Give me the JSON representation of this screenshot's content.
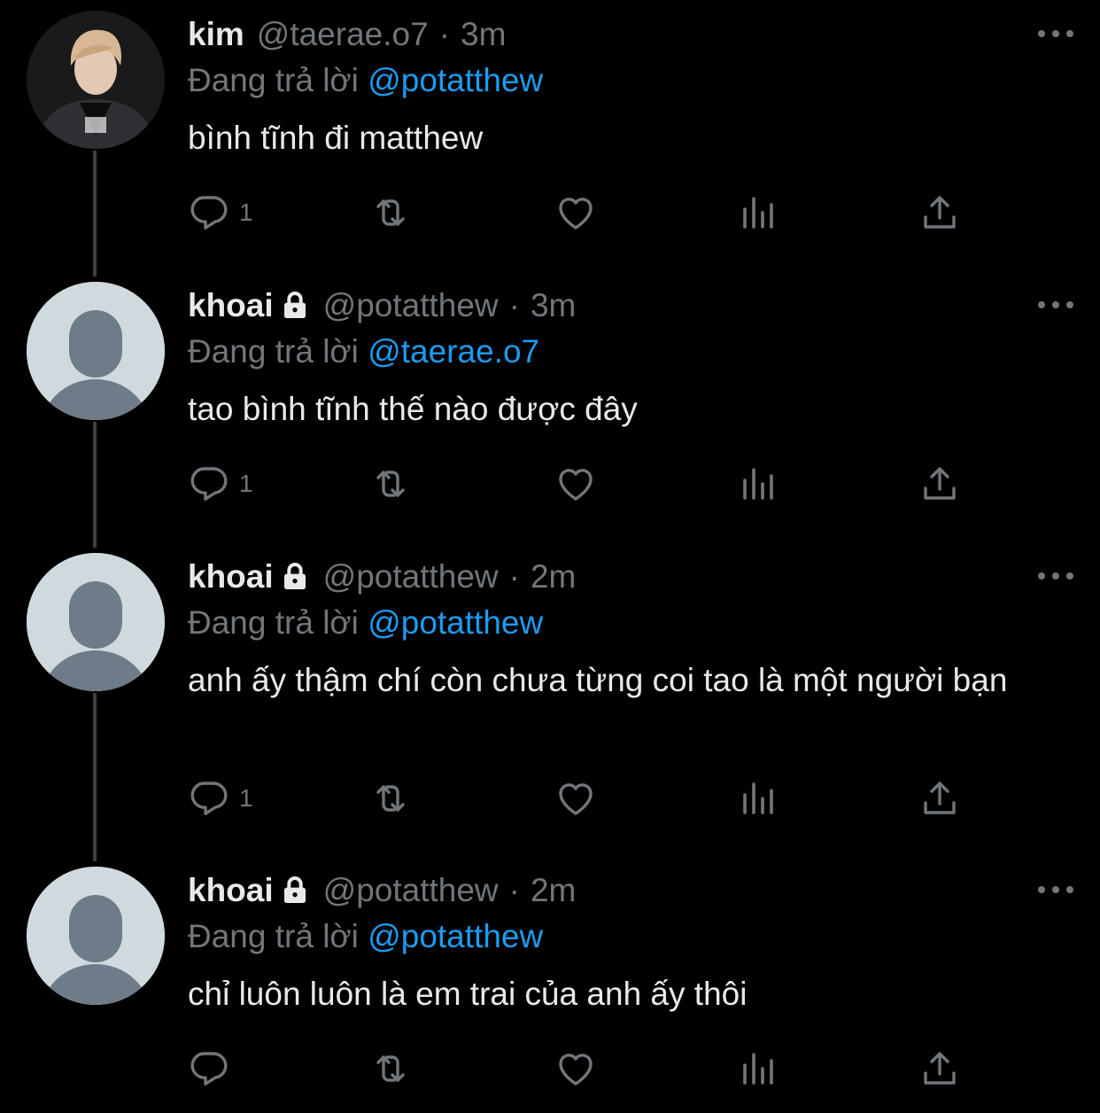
{
  "colors": {
    "background": "#000000",
    "text": "#e7e9ea",
    "muted": "#71767b",
    "link": "#1d9bf0",
    "thread_line": "#3e4144"
  },
  "tweets": [
    {
      "avatar": "profile-photo",
      "name": "kim",
      "locked": false,
      "handle": "@taerae.o7",
      "separator": "·",
      "time": "3m",
      "reply_label": "Đang trả lời",
      "reply_to": "@potatthew",
      "text": "bình tĩnh đi matthew",
      "reply_count": "1"
    },
    {
      "avatar": "default-avatar",
      "name": "khoai",
      "locked": true,
      "handle": "@potatthew",
      "separator": "·",
      "time": "3m",
      "reply_label": "Đang trả lời",
      "reply_to": "@taerae.o7",
      "text": "tao bình tĩnh thế nào được đây",
      "reply_count": "1"
    },
    {
      "avatar": "default-avatar",
      "name": "khoai",
      "locked": true,
      "handle": "@potatthew",
      "separator": "·",
      "time": "2m",
      "reply_label": "Đang trả lời",
      "reply_to": "@potatthew",
      "text": "anh ấy thậm chí còn chưa từng coi tao là một người bạn",
      "reply_count": "1"
    },
    {
      "avatar": "default-avatar",
      "name": "khoai",
      "locked": true,
      "handle": "@potatthew",
      "separator": "·",
      "time": "2m",
      "reply_label": "Đang trả lời",
      "reply_to": "@potatthew",
      "text": "chỉ luôn luôn là em trai của anh ấy thôi",
      "reply_count": ""
    }
  ],
  "icons": [
    "reply-icon",
    "retweet-icon",
    "like-icon",
    "views-icon",
    "share-icon",
    "more-icon",
    "lock-icon"
  ]
}
